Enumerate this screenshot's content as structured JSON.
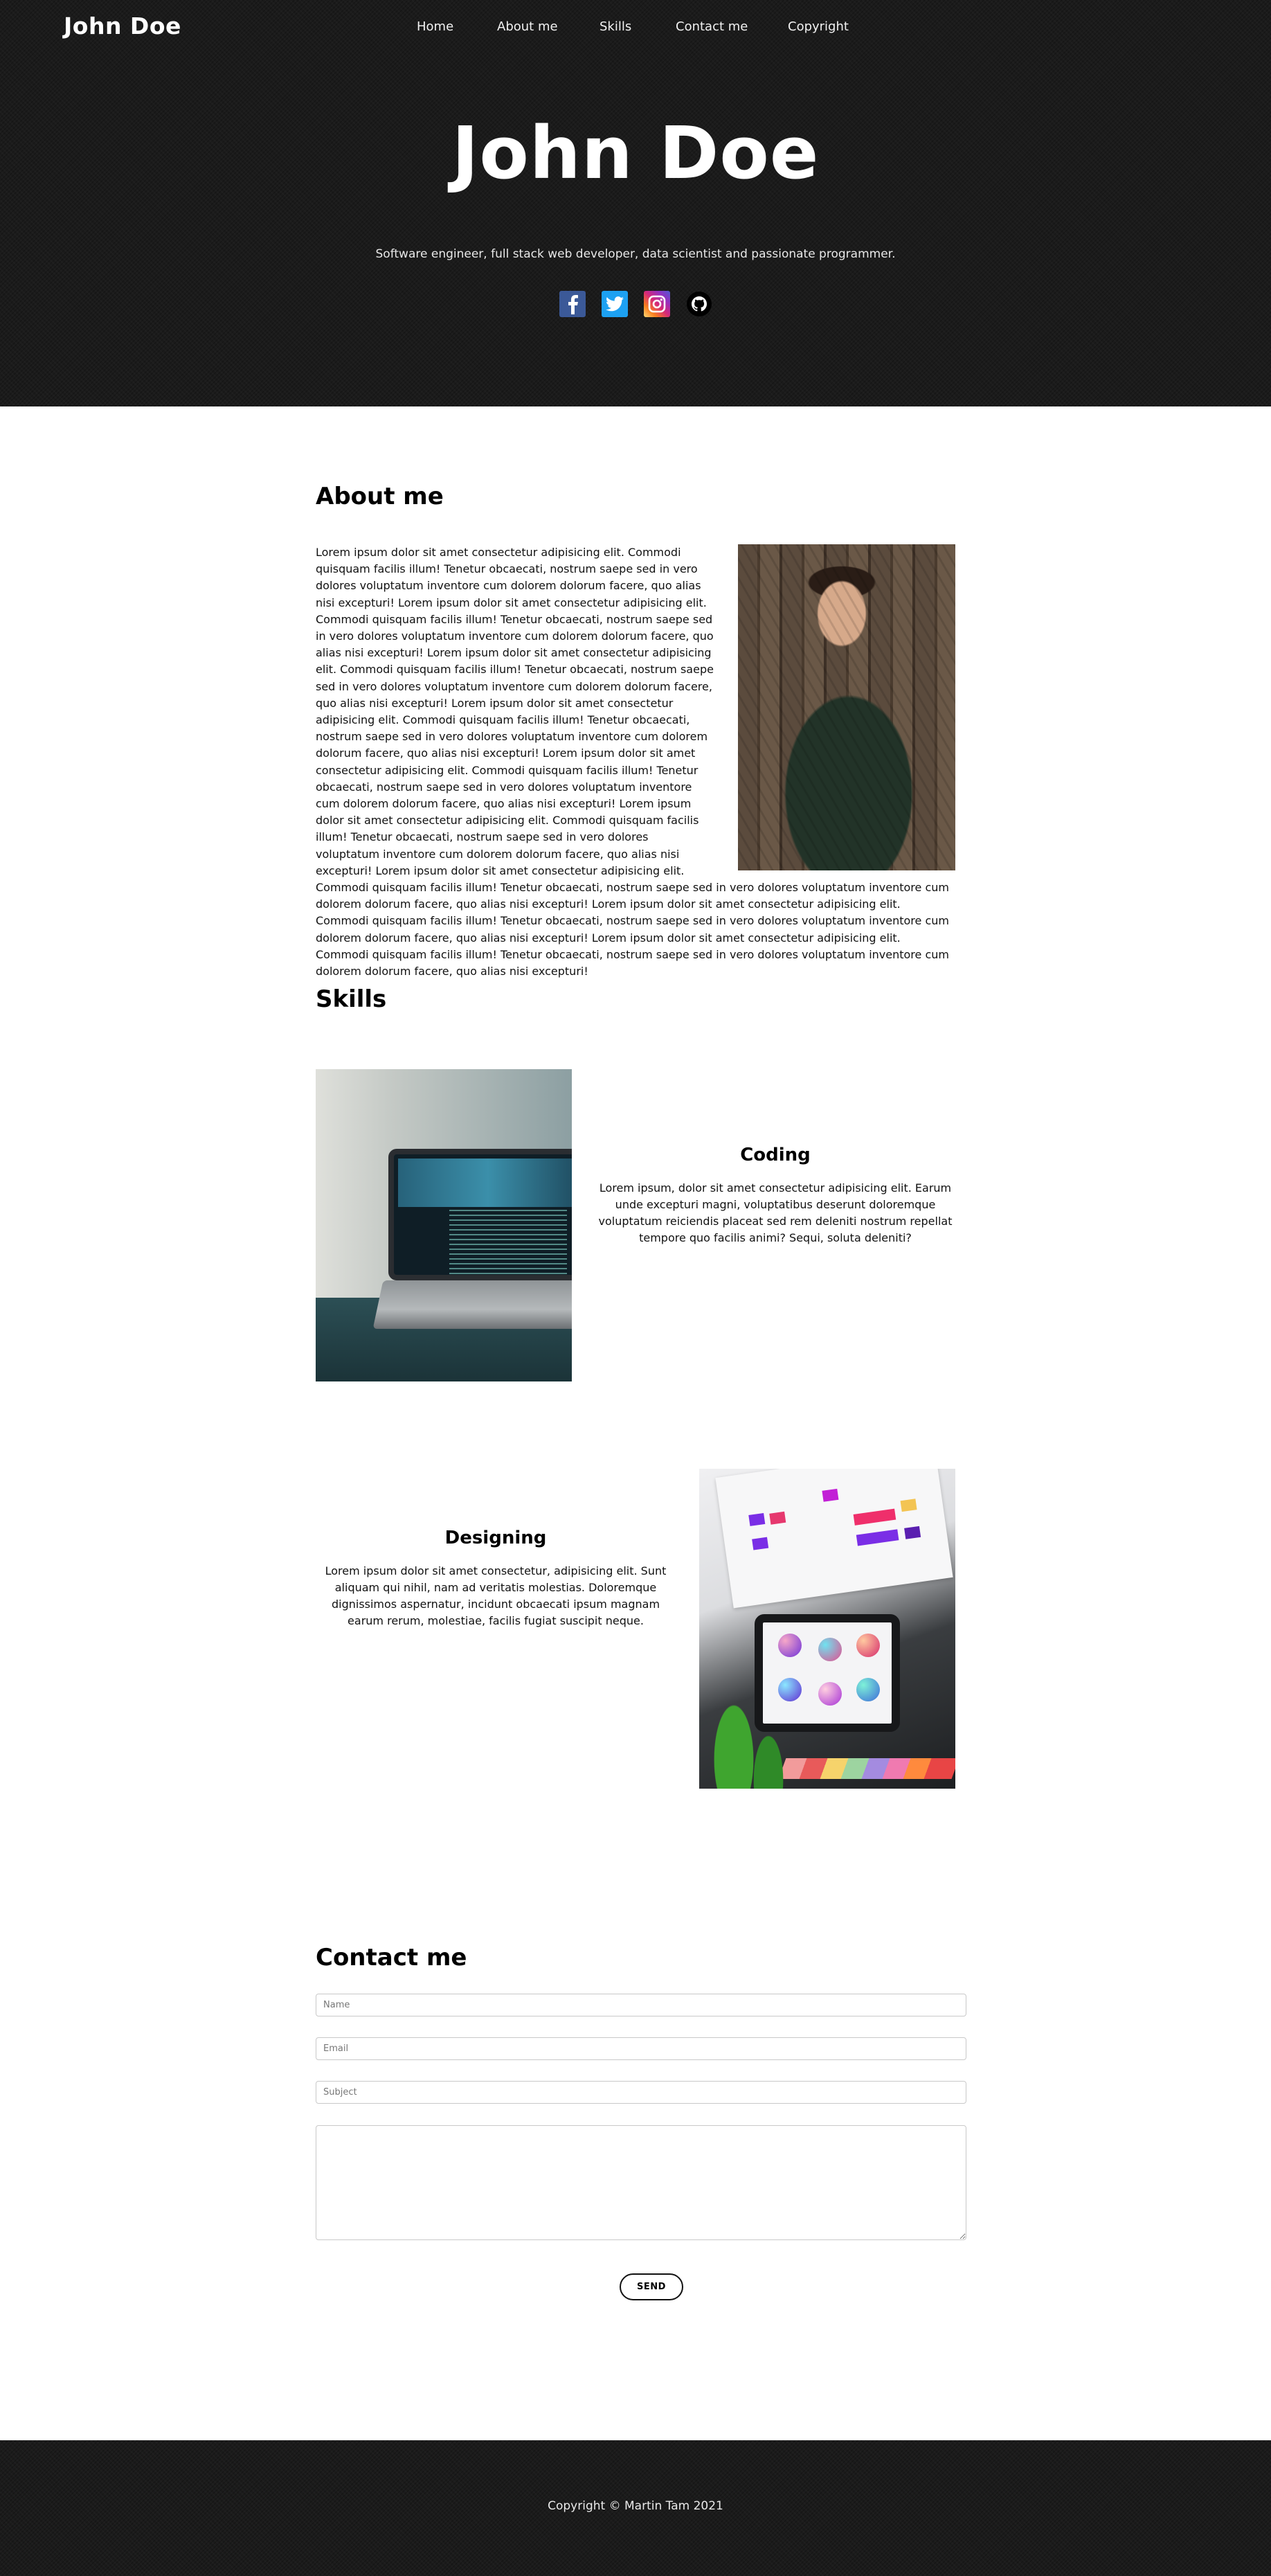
{
  "header": {
    "brand": "John Doe",
    "nav": [
      {
        "label": "Home"
      },
      {
        "label": "About me"
      },
      {
        "label": "Skills"
      },
      {
        "label": "Contact me"
      },
      {
        "label": "Copyright"
      }
    ]
  },
  "hero": {
    "title": "John Doe",
    "subtitle": "Software engineer, full stack web developer, data scientist and passionate programmer.",
    "socials": [
      {
        "icon": "facebook-icon",
        "color": "#3b5998"
      },
      {
        "icon": "twitter-icon",
        "color": "#1da1f2"
      },
      {
        "icon": "instagram-icon",
        "color": "#d62976"
      },
      {
        "icon": "github-icon",
        "color": "#000000"
      }
    ]
  },
  "about": {
    "heading": "About me",
    "text": "Lorem ipsum dolor sit amet consectetur adipisicing elit. Commodi quisquam facilis illum! Tenetur obcaecati, nostrum saepe sed in vero dolores voluptatum inventore cum dolorem dolorum facere, quo alias nisi excepturi! Lorem ipsum dolor sit amet consectetur adipisicing elit. Commodi quisquam facilis illum! Tenetur obcaecati, nostrum saepe sed in vero dolores voluptatum inventore cum dolorem dolorum facere, quo alias nisi excepturi! Lorem ipsum dolor sit amet consectetur adipisicing elit. Commodi quisquam facilis illum! Tenetur obcaecati, nostrum saepe sed in vero dolores voluptatum inventore cum dolorem dolorum facere, quo alias nisi excepturi! Lorem ipsum dolor sit amet consectetur adipisicing elit. Commodi quisquam facilis illum! Tenetur obcaecati, nostrum saepe sed in vero dolores voluptatum inventore cum dolorem dolorum facere, quo alias nisi excepturi! Lorem ipsum dolor sit amet consectetur adipisicing elit. Commodi quisquam facilis illum! Tenetur obcaecati, nostrum saepe sed in vero dolores voluptatum inventore cum dolorem dolorum facere, quo alias nisi excepturi! Lorem ipsum dolor sit amet consectetur adipisicing elit. Commodi quisquam facilis illum! Tenetur obcaecati, nostrum saepe sed in vero dolores voluptatum inventore cum dolorem dolorum facere, quo alias nisi excepturi! Lorem ipsum dolor sit amet consectetur adipisicing elit. Commodi quisquam facilis illum! Tenetur obcaecati, nostrum saepe sed in vero dolores voluptatum inventore cum dolorem dolorum facere, quo alias nisi excepturi! Lorem ipsum dolor sit amet consectetur adipisicing elit. Commodi quisquam facilis illum! Tenetur obcaecati, nostrum saepe sed in vero dolores voluptatum inventore cum dolorem dolorum facere, quo alias nisi excepturi! Lorem ipsum dolor sit amet consectetur adipisicing elit. Commodi quisquam facilis illum! Tenetur obcaecati, nostrum saepe sed in vero dolores voluptatum inventore cum dolorem dolorum facere, quo alias nisi excepturi!"
  },
  "skills": {
    "heading": "Skills",
    "items": [
      {
        "title": "Coding",
        "text": "Lorem ipsum, dolor sit amet consectetur adipisicing elit. Earum unde excepturi magni, voluptatibus deserunt doloremque voluptatum reiciendis placeat sed rem deleniti nostrum repellat tempore quo facilis animi? Sequi, soluta deleniti?"
      },
      {
        "title": "Designing",
        "text": "Lorem ipsum dolor sit amet consectetur, adipisicing elit. Sunt aliquam qui nihil, nam ad veritatis molestias. Doloremque dignissimos aspernatur, incidunt obcaecati ipsum magnam earum rerum, molestiae, facilis fugiat suscipit neque."
      }
    ]
  },
  "contact": {
    "heading": "Contact me",
    "name_placeholder": "Name",
    "email_placeholder": "Email",
    "subject_placeholder": "Subject",
    "message_placeholder": "",
    "send_label": "SEND"
  },
  "footer": {
    "text": "Copyright © Martin Tam 2021"
  },
  "colors": {
    "dark_background": "#1b1b1b",
    "text": "#111111"
  }
}
